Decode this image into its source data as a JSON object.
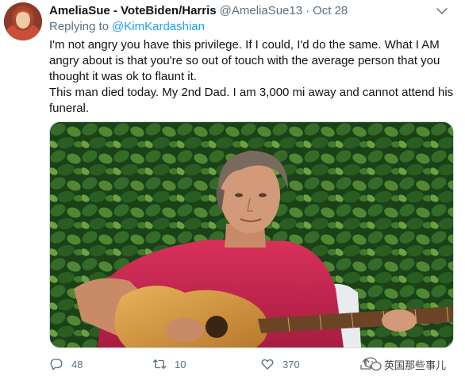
{
  "tweet": {
    "author_name": "AmeliaSue - VoteBiden/Harris",
    "handle": "@AmeliaSue13",
    "separator": "·",
    "date": "Oct 28",
    "replying_to_label": "Replying to",
    "replying_to_mention": "@KimKardashian",
    "body_paragraph_1": "I'm not angry you have this privilege. If I could, I'd do the same. What I AM angry about is that you're so out of touch with the average person that you thought it was ok to flaunt it.",
    "body_paragraph_2": "This man died today. My 2nd Dad. I am 3,000 mi away and cannot attend his funeral."
  },
  "actions": {
    "reply_count": "48",
    "retweet_count": "10",
    "like_count": "370"
  },
  "watermark": {
    "text": "英国那些事儿"
  },
  "icons": {
    "caret": "chevron-down-icon",
    "reply": "comment-icon",
    "retweet": "retweet-icon",
    "like": "heart-icon",
    "share": "share-icon"
  },
  "colors": {
    "link": "#1da1f2",
    "secondary_text": "#5b7083",
    "primary_text": "#0f1419"
  }
}
